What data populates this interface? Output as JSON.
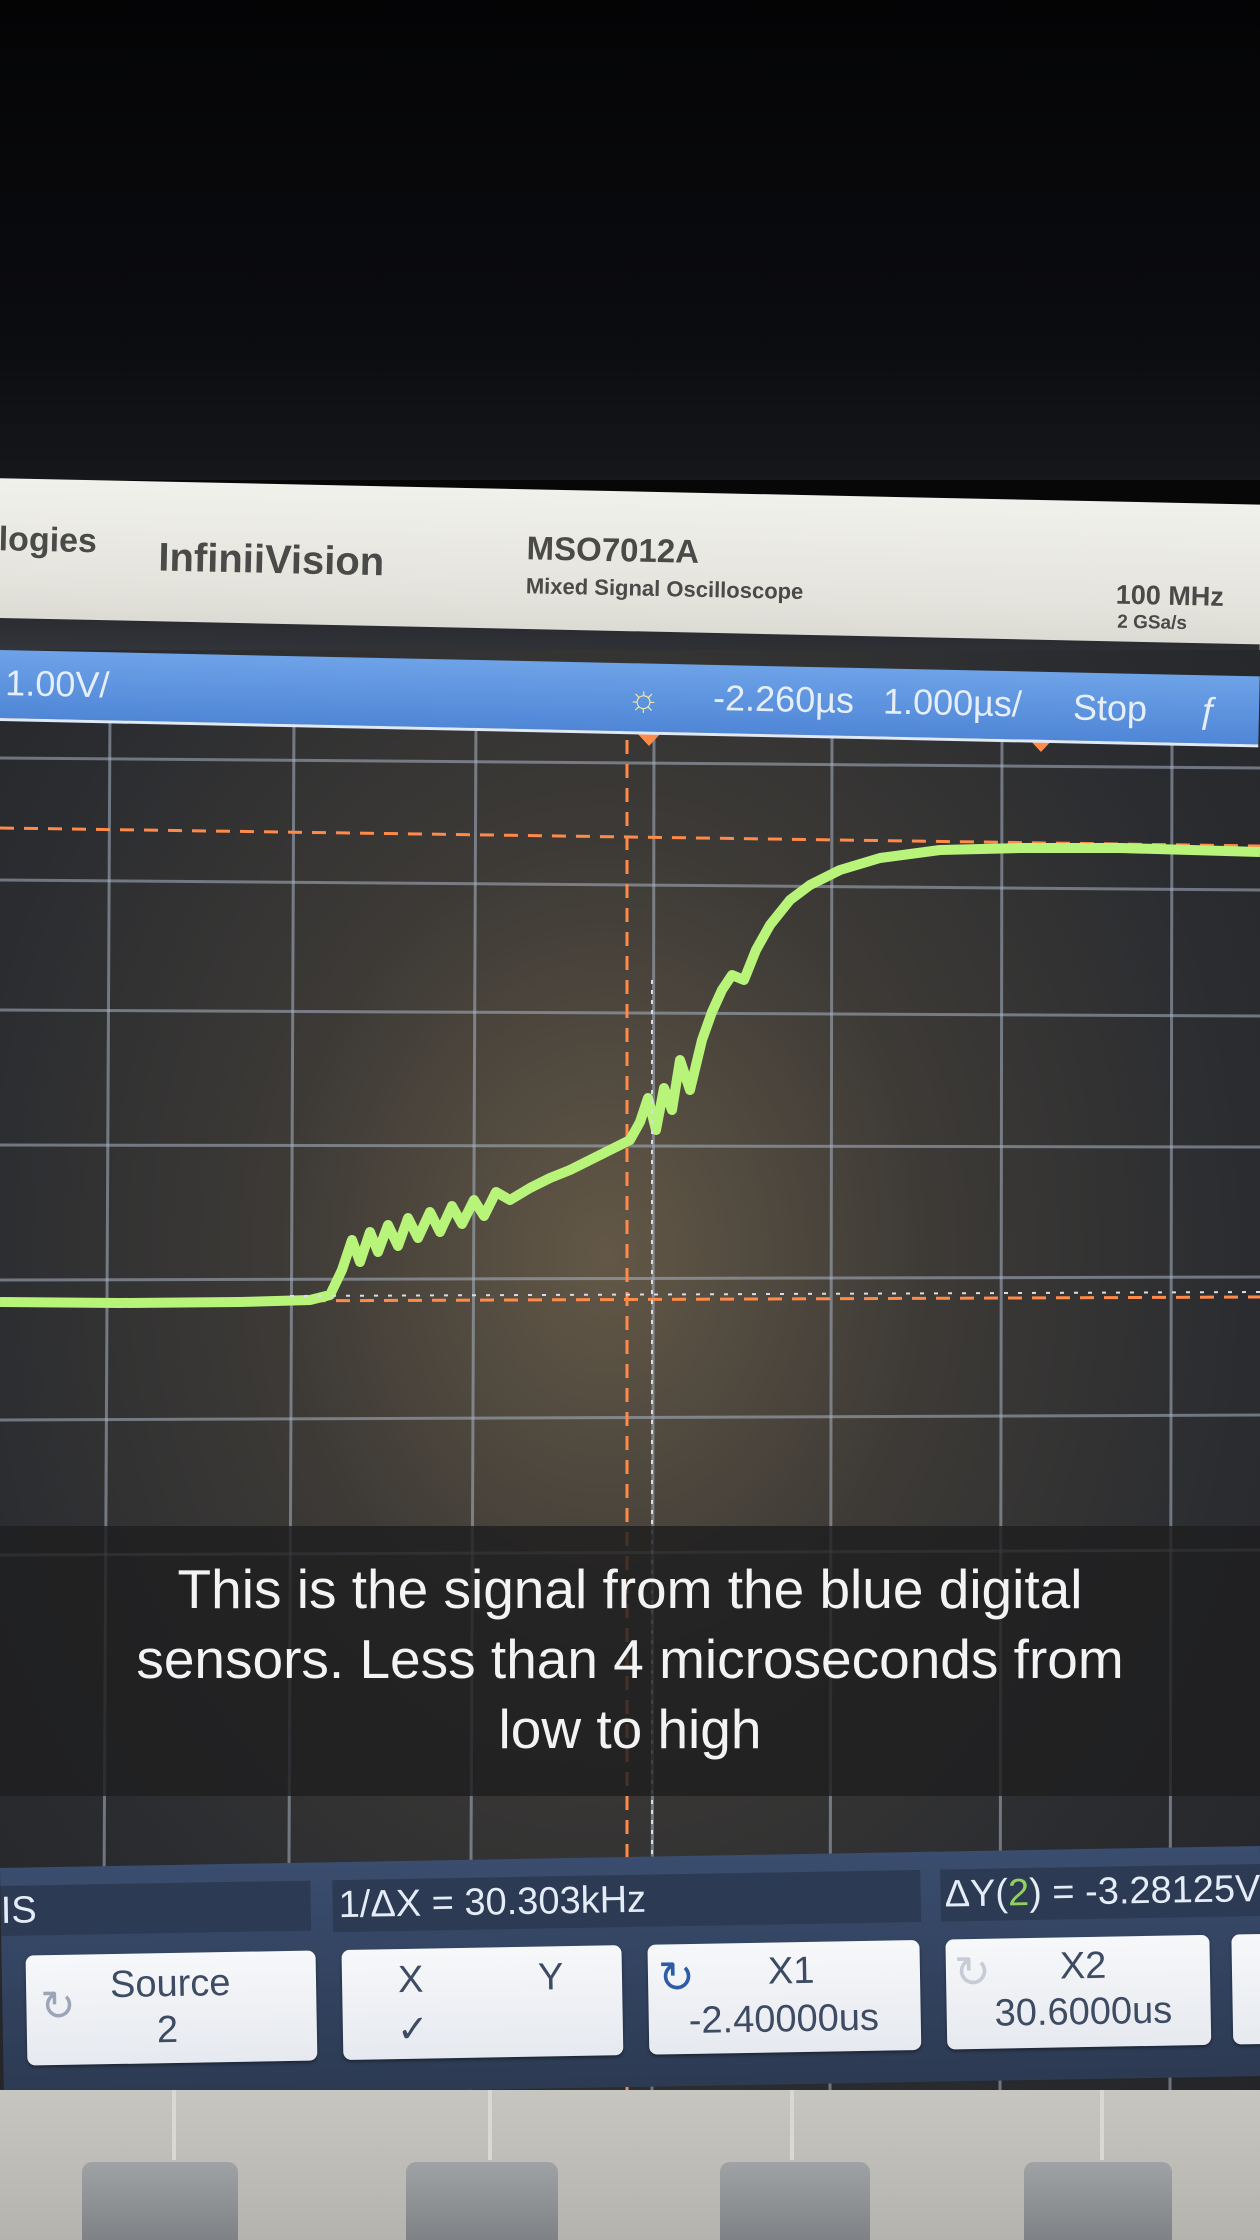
{
  "bezel": {
    "brand_left": "logies",
    "brand": "InfiniiVision",
    "model": "MSO7012A",
    "model_subtitle": "Mixed Signal Oscilloscope",
    "bandwidth": "100 MHz",
    "sample_rate": "2 GSa/s"
  },
  "status_bar": {
    "channel_scale": "1.00V/",
    "delay": "-2.260µs",
    "timebase": "1.000µs/",
    "run_state": "Stop",
    "trigger_edge_symbol": "ƒ"
  },
  "measurements": {
    "left_fragment": "IS",
    "inverse_delta_x": "1/ΔX = 30.303kHz",
    "delta_y_prefix": "ΔY(",
    "delta_y_source": "2",
    "delta_y_suffix": ") = -3.28125V"
  },
  "softkeys": {
    "source_label": "Source",
    "source_value": "2",
    "x_label": "X",
    "y_label": "Y",
    "check": "✓",
    "x1_label": "X1",
    "x1_value": "-2.40000us",
    "x2_label": "X2",
    "x2_value": "30.6000us"
  },
  "caption": {
    "line1": "This is the signal from the blue digital",
    "line2": "sensors. Less than 4 microseconds from",
    "line3": "low to high"
  },
  "colors": {
    "trace": "#b8f47a",
    "cursor": "#ff8a4a",
    "status_bar": "#5a8fdc",
    "grid": "#aab4c4"
  }
}
